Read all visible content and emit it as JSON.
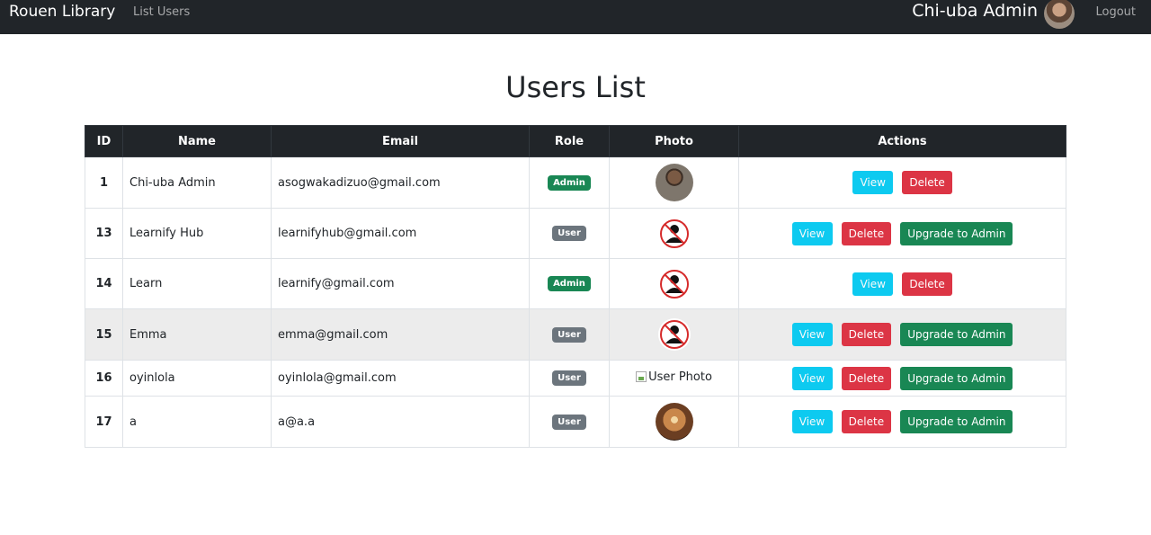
{
  "navbar": {
    "brand": "Rouen Library",
    "list_users": "List Users",
    "user_name": "Chi-uba Admin",
    "logout": "Logout"
  },
  "page": {
    "title": "Users List"
  },
  "table": {
    "headers": [
      "ID",
      "Name",
      "Email",
      "Role",
      "Photo",
      "Actions"
    ],
    "buttons": {
      "view": "View",
      "delete": "Delete",
      "upgrade": "Upgrade to Admin"
    },
    "rows": [
      {
        "id": "1",
        "name": "Chi-uba Admin",
        "email": "asogwakadizuo@gmail.com",
        "role": "Admin",
        "photo": "person-photo"
      },
      {
        "id": "13",
        "name": "Learnify Hub",
        "email": "learnifyhub@gmail.com",
        "role": "User",
        "photo": "no-user-icon"
      },
      {
        "id": "14",
        "name": "Learn",
        "email": "learnify@gmail.com",
        "role": "Admin",
        "photo": "no-user-icon"
      },
      {
        "id": "15",
        "name": "Emma",
        "email": "emma@gmail.com",
        "role": "User",
        "photo": "no-user-icon"
      },
      {
        "id": "16",
        "name": "oyinlola",
        "email": "oyinlola@gmail.com",
        "role": "User",
        "photo_alt": "User Photo"
      },
      {
        "id": "17",
        "name": "a",
        "email": "a@a.a",
        "role": "User",
        "photo": "glow-photo"
      }
    ]
  },
  "colors": {
    "navbar_bg": "#212529",
    "admin_badge": "#198754",
    "user_badge": "#6c757d",
    "view_button": "#0dcaf0",
    "delete_button": "#dc3545",
    "upgrade_button": "#198754"
  }
}
